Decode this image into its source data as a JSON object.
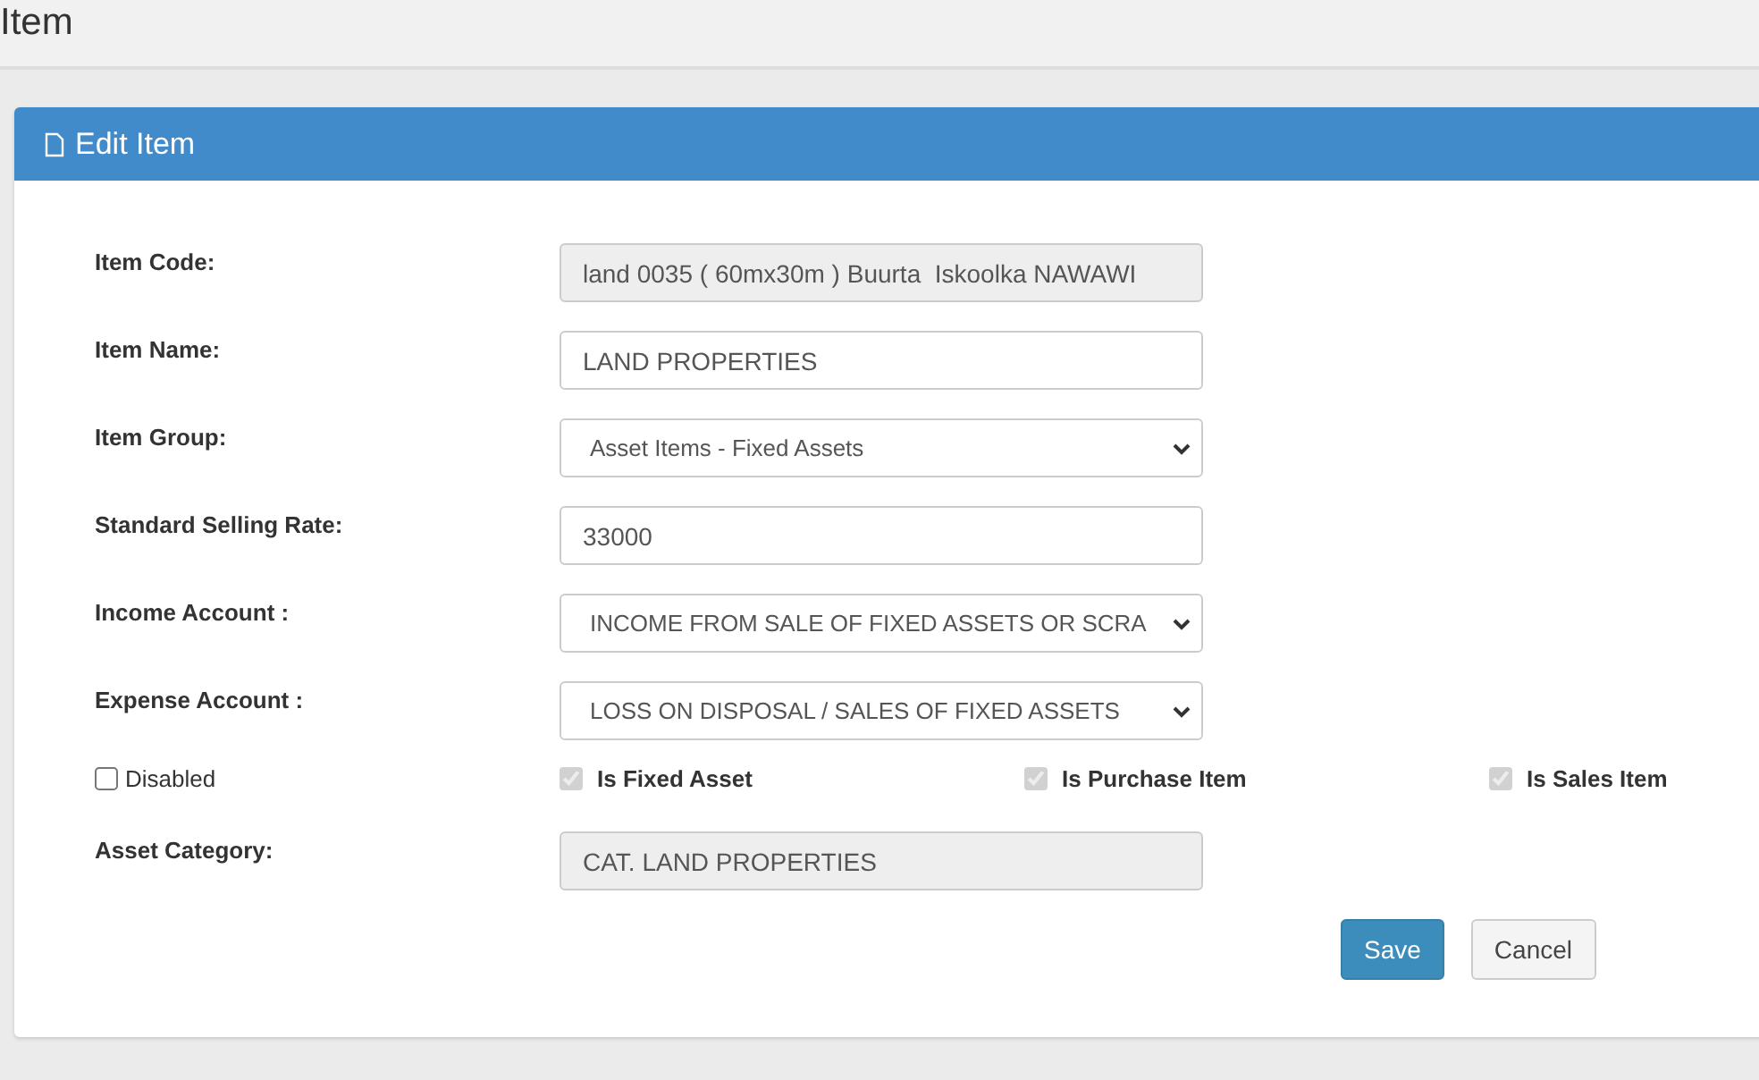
{
  "page": {
    "title": "Item"
  },
  "panel": {
    "title": "Edit Item"
  },
  "fields": [
    {
      "label": "Item Code:",
      "kind": "text",
      "value": "land 0035 ( 60mx30m ) Buurta  Iskoolka NAWAWI",
      "disabled": true
    },
    {
      "label": "Item Name:",
      "kind": "text",
      "value": "LAND PROPERTIES",
      "disabled": false
    },
    {
      "label": "Item Group:",
      "kind": "select",
      "value": "Asset Items - Fixed Assets",
      "disabled": false
    },
    {
      "label": "Standard Selling Rate:",
      "kind": "text",
      "value": "33000",
      "disabled": false
    },
    {
      "label": "Income Account :",
      "kind": "select",
      "value": "INCOME FROM SALE OF FIXED ASSETS OR SCRA",
      "disabled": false
    },
    {
      "label": "Expense Account :",
      "kind": "select",
      "value": "LOSS ON DISPOSAL / SALES OF FIXED ASSETS",
      "disabled": false
    }
  ],
  "checkboxes": [
    {
      "label": "Disabled",
      "checked": false,
      "disabled": false
    },
    {
      "label": "Is Fixed Asset",
      "checked": true,
      "disabled": true
    },
    {
      "label": "Is Purchase Item",
      "checked": true,
      "disabled": true
    },
    {
      "label": "Is Sales Item",
      "checked": true,
      "disabled": true
    }
  ],
  "asset_category": {
    "label": "Asset Category:",
    "kind": "text",
    "value": "CAT. LAND PROPERTIES",
    "disabled": true
  },
  "buttons": [
    {
      "label": "Save",
      "kind": "primary"
    },
    {
      "label": "Cancel",
      "kind": "default"
    }
  ]
}
